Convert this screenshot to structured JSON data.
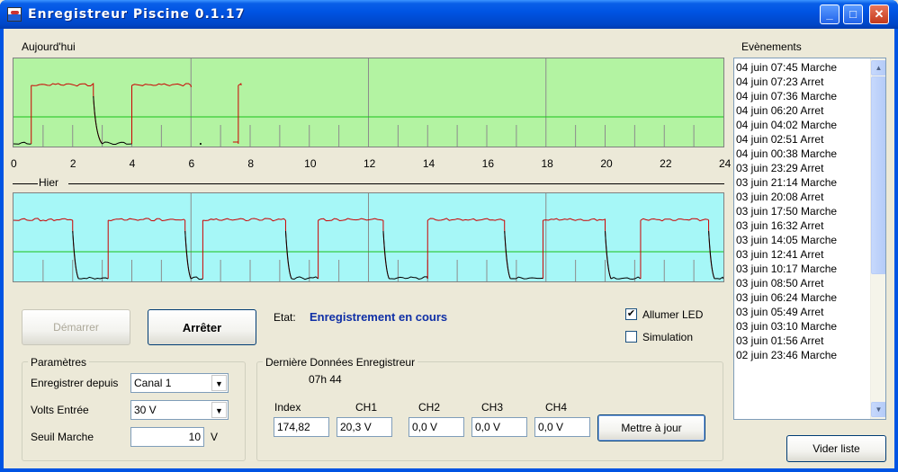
{
  "window": {
    "title": "Enregistreur Piscine 0.1.17",
    "minimize": "_",
    "maximize": "□",
    "close": "✕"
  },
  "today": {
    "label": "Aujourd'hui",
    "bg": "#b3f3a2",
    "x_ticks": [
      "0",
      "2",
      "4",
      "6",
      "8",
      "10",
      "12",
      "14",
      "16",
      "18",
      "20",
      "22",
      "24"
    ]
  },
  "yesterday": {
    "label": "Hier",
    "bg": "#a6f7f7"
  },
  "chart_data": [
    {
      "type": "line",
      "name": "Aujourd'hui",
      "xlim": [
        0,
        24
      ],
      "x_ticks": [
        0,
        2,
        4,
        6,
        8,
        10,
        12,
        14,
        16,
        18,
        20,
        22,
        24
      ],
      "threshold": 10,
      "series": [
        {
          "color": "#cc0000",
          "states": [
            [
              0.0,
              "low"
            ],
            [
              0.6,
              "high"
            ],
            [
              2.7,
              "falling"
            ],
            [
              3.0,
              "low"
            ],
            [
              4.0,
              "high"
            ],
            [
              6.0,
              "gap"
            ],
            [
              7.6,
              "high"
            ]
          ]
        }
      ]
    },
    {
      "type": "line",
      "name": "Hier",
      "xlim": [
        0,
        24
      ],
      "threshold": 10,
      "series": [
        {
          "color": "#cc0000",
          "states": [
            [
              0.0,
              "high"
            ],
            [
              2.0,
              "falling"
            ],
            [
              2.2,
              "low"
            ],
            [
              3.2,
              "high"
            ],
            [
              5.8,
              "falling"
            ],
            [
              6.0,
              "low"
            ],
            [
              6.4,
              "high"
            ],
            [
              9.2,
              "falling"
            ],
            [
              9.4,
              "low"
            ],
            [
              10.3,
              "high"
            ],
            [
              12.5,
              "falling"
            ],
            [
              12.7,
              "low"
            ],
            [
              14.0,
              "high"
            ],
            [
              16.6,
              "falling"
            ],
            [
              16.8,
              "low"
            ],
            [
              17.9,
              "high"
            ],
            [
              20.0,
              "falling"
            ],
            [
              20.2,
              "low"
            ],
            [
              21.2,
              "high"
            ],
            [
              23.5,
              "falling"
            ],
            [
              23.7,
              "low"
            ]
          ]
        }
      ]
    }
  ],
  "controls": {
    "start": "Démarrer",
    "stop": "Arrêter",
    "etat_label": "Etat:",
    "etat_value": "Enregistrement en cours",
    "led_label": "Allumer LED",
    "led_checked": "✔",
    "sim_label": "Simulation"
  },
  "params": {
    "title": "Paramètres",
    "source_label": "Enregistrer depuis",
    "source_value": "Canal 1",
    "volts_label": "Volts Entrée",
    "volts_value": "30 V",
    "seuil_label": "Seuil Marche",
    "seuil_value": "10",
    "seuil_unit": "V",
    "arrow": "▼"
  },
  "last": {
    "title": "Dernière Données Enregistreur",
    "time": "07h 44",
    "headers": [
      "Index",
      "CH1",
      "CH2",
      "CH3",
      "CH4"
    ],
    "values": [
      "174,82",
      "20,3 V",
      "0,0 V",
      "0,0 V",
      "0,0 V"
    ],
    "update": "Mettre à jour"
  },
  "events": {
    "label": "Evènements",
    "clear": "Vider liste",
    "up": "▲",
    "down": "▼",
    "items": [
      "04 juin 07:45 Marche",
      "04 juin 07:23 Arret",
      "04 juin 07:36 Marche",
      "04 juin 06:20 Arret",
      "04 juin 04:02 Marche",
      "04 juin 02:51 Arret",
      "04 juin 00:38 Marche",
      "03 juin 23:29 Arret",
      "03 juin 21:14 Marche",
      "03 juin 20:08 Arret",
      "03 juin 17:50 Marche",
      "03 juin 16:32 Arret",
      "03 juin 14:05 Marche",
      "03 juin 12:41 Arret",
      "03 juin 10:17 Marche",
      "03 juin 08:50 Arret",
      "03 juin 06:24 Marche",
      "03 juin 05:49 Arret",
      "03 juin 03:10 Marche",
      "03 juin 01:56 Arret",
      "02 juin 23:46 Marche"
    ]
  }
}
